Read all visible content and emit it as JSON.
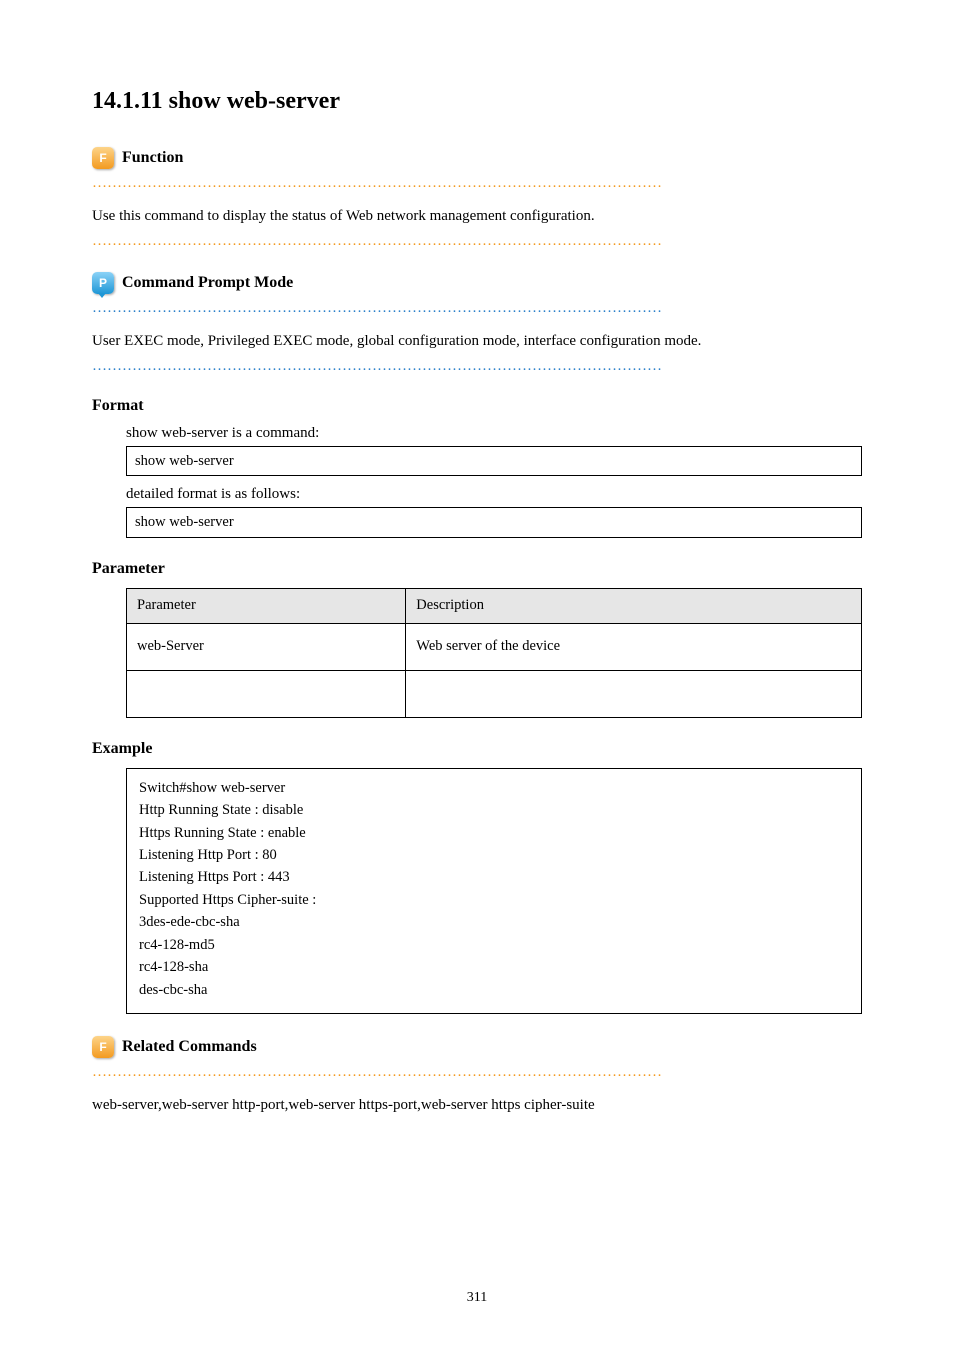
{
  "title": "14.1.11 show web-server",
  "sections": {
    "function": {
      "heading": "Function",
      "body": "Use this command to display the status of Web network management configuration."
    },
    "prompt": {
      "heading": "Command Prompt Mode",
      "body": "User EXEC mode, Privileged EXEC mode, global configuration mode, interface configuration mode."
    }
  },
  "syntax": {
    "heading": "Format",
    "command_label": "show web-server is a command:",
    "command_text": "show web-server",
    "detailed_label": "detailed format is as follows:",
    "detailed_text": "show web-server"
  },
  "parameters": {
    "heading": "Parameter",
    "head_param": "Parameter",
    "head_desc": "Description",
    "rows": [
      {
        "param": "web-Server",
        "desc": "Web server of the device"
      }
    ]
  },
  "example": {
    "heading": "Example",
    "code": "Switch#show web-server\nHttp  Running State   : disable\nHttps Running State   : enable\nListening Http  Port   : 80\nListening Https Port   : 443\nSupported Https Cipher-suite :\n    3des-ede-cbc-sha\n    rc4-128-md5\n    rc4-128-sha\n    des-cbc-sha"
  },
  "related": {
    "heading": "Related Commands",
    "body": "web-server,web-server http-port,web-server https-port,web-server https cipher-suite"
  },
  "page_number": "311"
}
